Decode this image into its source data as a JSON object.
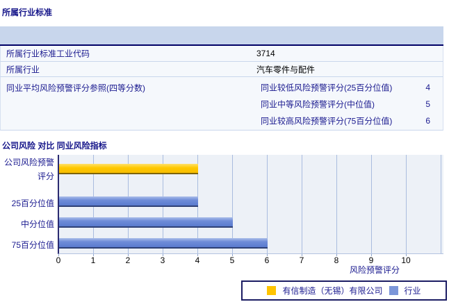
{
  "industry_section": {
    "title": "所属行业标准",
    "rows": [
      {
        "label": "所属行业标准工业代码",
        "value": "3714"
      },
      {
        "label": "所属行业",
        "value": "汽车零件与配件"
      },
      {
        "label": "同业平均风险预警评分参照(四等分数)",
        "sub_rows": [
          {
            "label": "同业较低风险预警评分(25百分位值)",
            "value": "4"
          },
          {
            "label": "同业中等风险预警评分(中位值)",
            "value": "5"
          },
          {
            "label": "同业较高风险预警评分(75百分位值)",
            "value": "6"
          }
        ]
      }
    ]
  },
  "chart_section": {
    "title": "公司风险 对比 同业风险指标"
  },
  "chart_data": {
    "type": "bar",
    "orientation": "horizontal",
    "title": "公司风险 对比 同业风险指标",
    "categories": [
      "公司风险预警评分",
      "25百分位值",
      "中分位值",
      "75百分位值"
    ],
    "series": [
      {
        "name": "有信制造（无锡）有限公司",
        "color": "#ffc400",
        "values": [
          4,
          null,
          null,
          null
        ]
      },
      {
        "name": "行业",
        "color": "#7b96d9",
        "values": [
          null,
          4,
          5,
          6
        ]
      }
    ],
    "bars": [
      {
        "category": "公司风险预警评分",
        "series": "company",
        "value": 4
      },
      {
        "category": "25百分位值",
        "series": "industry",
        "value": 4
      },
      {
        "category": "中分位值",
        "series": "industry",
        "value": 5
      },
      {
        "category": "75百分位值",
        "series": "industry",
        "value": 6
      }
    ],
    "xlabel": "风险预警评分",
    "ylabel": "",
    "xlim": [
      0,
      11
    ],
    "xticks": [
      0,
      1,
      2,
      3,
      4,
      5,
      6,
      7,
      8,
      9,
      10
    ],
    "gridline_units": [
      1,
      2,
      3,
      4,
      5,
      6,
      7,
      8,
      9,
      10,
      11
    ],
    "grid": true,
    "legend_position": "bottom-right"
  },
  "colors": {
    "label_navy": "#1a1a8f",
    "value_black": "#000000",
    "header_band": "#c8d6ec",
    "header_band_line": "#000066",
    "row_bg": "#f5f8fc",
    "row_separator": "#c9d7ec",
    "plot_bg": "#edf1f7",
    "gridline": "#a9bcdf",
    "axis": "#2a2a70",
    "bar_yellow": "#ffc400",
    "bar_blue": "#7b96d9",
    "legend_border": "#1b1c63"
  }
}
